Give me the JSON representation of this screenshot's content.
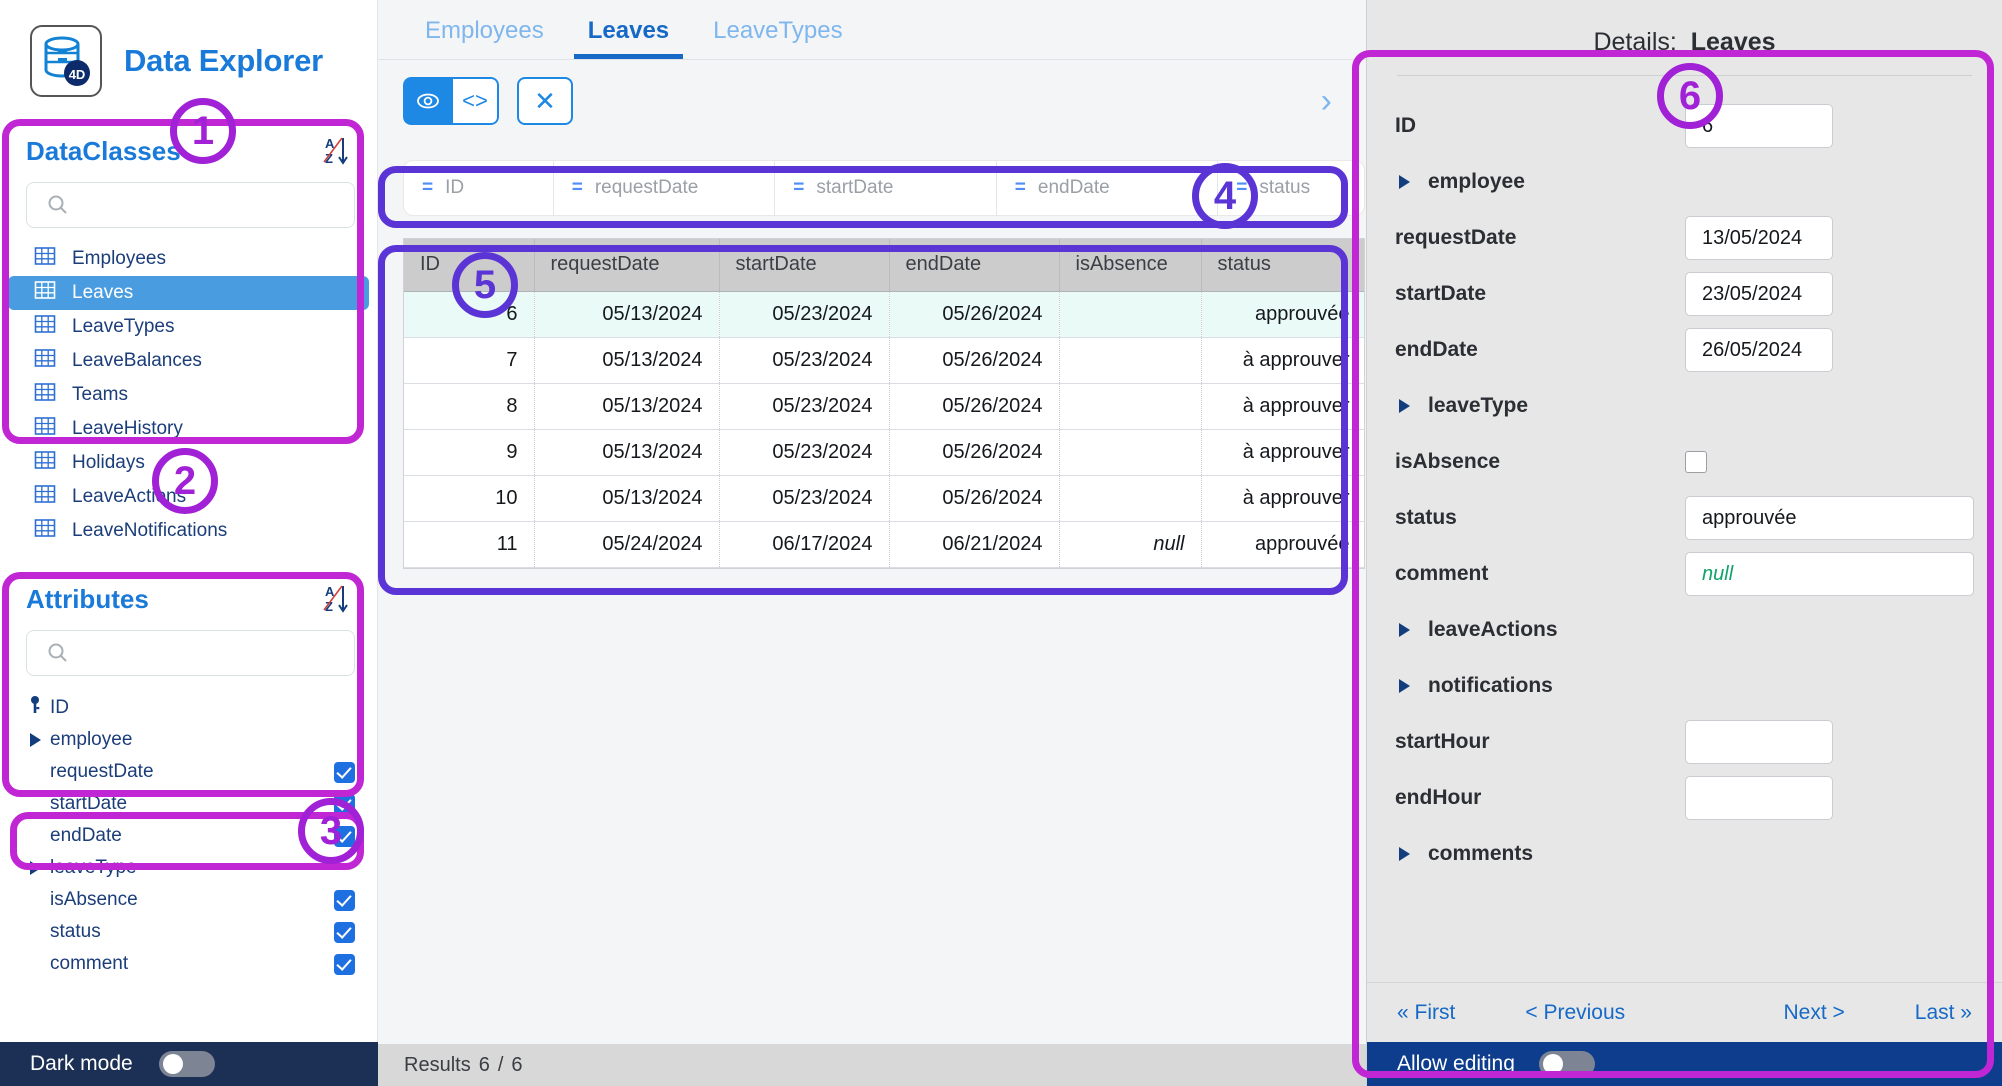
{
  "app": {
    "title": "Data Explorer",
    "logo_icon": "database-4d-icon"
  },
  "sidebar": {
    "dataclasses": {
      "title": "DataClasses",
      "sort_icon": "sort-az-descending-icon",
      "search_placeholder": "",
      "search_value": "",
      "items": [
        {
          "label": "Employees",
          "icon": "table-icon",
          "active": false
        },
        {
          "label": "Leaves",
          "icon": "table-icon",
          "active": true
        },
        {
          "label": "LeaveTypes",
          "icon": "table-icon",
          "active": false
        },
        {
          "label": "LeaveBalances",
          "icon": "table-icon",
          "active": false
        },
        {
          "label": "Teams",
          "icon": "table-icon",
          "active": false
        },
        {
          "label": "LeaveHistory",
          "icon": "table-icon",
          "active": false
        },
        {
          "label": "Holidays",
          "icon": "table-icon",
          "active": false
        },
        {
          "label": "LeaveActions",
          "icon": "table-icon",
          "active": false
        },
        {
          "label": "LeaveNotifications",
          "icon": "table-icon",
          "active": false
        }
      ]
    },
    "attributes": {
      "title": "Attributes",
      "sort_icon": "sort-az-descending-icon",
      "search_placeholder": "",
      "search_value": "",
      "items": [
        {
          "label": "ID",
          "lead": "key",
          "checked": false
        },
        {
          "label": "employee",
          "lead": "expand",
          "checked": false
        },
        {
          "label": "requestDate",
          "lead": "none",
          "checked": true
        },
        {
          "label": "startDate",
          "lead": "none",
          "checked": true
        },
        {
          "label": "endDate",
          "lead": "none",
          "checked": true
        },
        {
          "label": "leaveType",
          "lead": "expand",
          "checked": false
        },
        {
          "label": "isAbsence",
          "lead": "none",
          "checked": true
        },
        {
          "label": "status",
          "lead": "none",
          "checked": true
        },
        {
          "label": "comment",
          "lead": "none",
          "checked": true
        }
      ]
    },
    "dark_mode": {
      "label": "Dark mode",
      "enabled": false
    }
  },
  "main": {
    "tabs": [
      {
        "label": "Employees",
        "active": false
      },
      {
        "label": "Leaves",
        "active": true
      },
      {
        "label": "LeaveTypes",
        "active": false
      }
    ],
    "toolbar": {
      "preview_icon": "eye-icon",
      "code_icon": "code-brackets-icon",
      "clear_icon": "close-x-icon",
      "expand_icon": "chevron-right-icon"
    },
    "filter_bar": {
      "operator": "=",
      "cells": [
        "ID",
        "requestDate",
        "startDate",
        "endDate",
        "status"
      ]
    },
    "table": {
      "columns": [
        "ID",
        "requestDate",
        "startDate",
        "endDate",
        "isAbsence",
        "status"
      ],
      "rows": [
        {
          "ID": "6",
          "requestDate": "05/13/2024",
          "startDate": "05/23/2024",
          "endDate": "05/26/2024",
          "isAbsence": "",
          "status": "approuvée",
          "selected": true
        },
        {
          "ID": "7",
          "requestDate": "05/13/2024",
          "startDate": "05/23/2024",
          "endDate": "05/26/2024",
          "isAbsence": "",
          "status": "à approuver",
          "selected": false
        },
        {
          "ID": "8",
          "requestDate": "05/13/2024",
          "startDate": "05/23/2024",
          "endDate": "05/26/2024",
          "isAbsence": "",
          "status": "à approuver",
          "selected": false
        },
        {
          "ID": "9",
          "requestDate": "05/13/2024",
          "startDate": "05/23/2024",
          "endDate": "05/26/2024",
          "isAbsence": "",
          "status": "à approuver",
          "selected": false
        },
        {
          "ID": "10",
          "requestDate": "05/13/2024",
          "startDate": "05/23/2024",
          "endDate": "05/26/2024",
          "isAbsence": "",
          "status": "à approuver",
          "selected": false
        },
        {
          "ID": "11",
          "requestDate": "05/24/2024",
          "startDate": "06/17/2024",
          "endDate": "06/21/2024",
          "isAbsence": "null",
          "status": "approuvée",
          "selected": false
        }
      ]
    },
    "status_bar": {
      "label": "Results",
      "count": "6",
      "separator": "/",
      "total": "6"
    }
  },
  "details": {
    "header_prefix": "Details:",
    "header_title": "Leaves",
    "fields": [
      {
        "label": "ID",
        "type": "input",
        "value": "6",
        "size": "narrow"
      },
      {
        "label": "employee",
        "type": "relation"
      },
      {
        "label": "requestDate",
        "type": "input",
        "value": "13/05/2024",
        "size": "narrow"
      },
      {
        "label": "startDate",
        "type": "input",
        "value": "23/05/2024",
        "size": "narrow"
      },
      {
        "label": "endDate",
        "type": "input",
        "value": "26/05/2024",
        "size": "narrow"
      },
      {
        "label": "leaveType",
        "type": "relation"
      },
      {
        "label": "isAbsence",
        "type": "checkbox",
        "checked": false
      },
      {
        "label": "status",
        "type": "input",
        "value": "approuvée",
        "size": "wide"
      },
      {
        "label": "comment",
        "type": "input",
        "value": "null",
        "size": "wide",
        "isnull": true
      },
      {
        "label": "leaveActions",
        "type": "relation"
      },
      {
        "label": "notifications",
        "type": "relation"
      },
      {
        "label": "startHour",
        "type": "input",
        "value": "",
        "size": "narrow"
      },
      {
        "label": "endHour",
        "type": "input",
        "value": "",
        "size": "narrow"
      },
      {
        "label": "comments",
        "type": "relation"
      }
    ],
    "nav": {
      "first": "« First",
      "previous": "< Previous",
      "next": "Next >",
      "last": "Last »"
    },
    "allow_editing": {
      "label": "Allow editing",
      "enabled": false
    }
  },
  "annotations": [
    {
      "number": "1",
      "target": "dataclasses-panel"
    },
    {
      "number": "2",
      "target": "attributes-panel"
    },
    {
      "number": "3",
      "target": "status-bar"
    },
    {
      "number": "4",
      "target": "filter-bar"
    },
    {
      "number": "5",
      "target": "data-grid"
    },
    {
      "number": "6",
      "target": "details-panel"
    }
  ],
  "colors": {
    "accent_blue": "#1769c7",
    "annotation_magenta": "#c026d3",
    "annotation_indigo": "#5b34d6",
    "selected_row": "#4a9ce0",
    "null_green": "#11a36b"
  }
}
